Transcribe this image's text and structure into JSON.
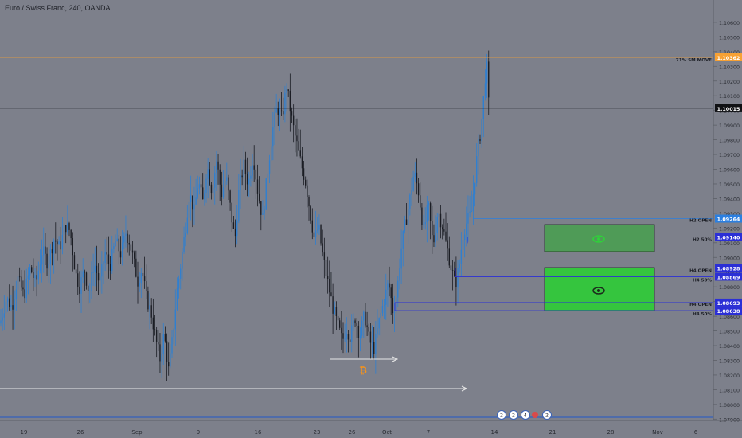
{
  "header": {
    "title": "Euro / Swiss Franc, 240, OANDA"
  },
  "colors": {
    "background": "#7d808b",
    "candle_up": "#2f7fd0",
    "candle_down": "#1b1d24",
    "orange_line": "#f7a134",
    "zone_dark": "#4f9b57",
    "zone_bright": "#35c53e",
    "level_line": "#2b2fd6",
    "open_level": "#2b7fe0"
  },
  "chart_data": {
    "type": "line",
    "instrument": "Euro / Swiss Franc",
    "timeframe": "240",
    "source": "OANDA",
    "x_tick_labels": [
      "19",
      "26",
      "Sep",
      "9",
      "16",
      "23",
      "26",
      "Oct",
      "7",
      "14",
      "21",
      "28",
      "Nov",
      "6"
    ],
    "y_tick_labels": [
      "1.10600",
      "1.10500",
      "1.10400",
      "1.10300",
      "1.10200",
      "1.10100",
      "1.10000",
      "1.09900",
      "1.09800",
      "1.09700",
      "1.09600",
      "1.09500",
      "1.09400",
      "1.09300",
      "1.09200",
      "1.09100",
      "1.09000",
      "1.08900",
      "1.08800",
      "1.08700",
      "1.08600",
      "1.08500",
      "1.08400",
      "1.08300",
      "1.08200",
      "1.08100",
      "1.08000",
      "1.07900"
    ],
    "ylim": [
      1.0788,
      1.1067
    ],
    "series": [
      {
        "price_path": [
          [
            0,
            1.0855
          ],
          [
            8,
            1.0872
          ],
          [
            15,
            1.0866
          ],
          [
            22,
            1.0886
          ],
          [
            30,
            1.0874
          ],
          [
            38,
            1.0893
          ],
          [
            45,
            1.0882
          ],
          [
            53,
            1.0905
          ],
          [
            60,
            1.0896
          ],
          [
            68,
            1.0913
          ],
          [
            75,
            1.0906
          ],
          [
            82,
            1.0922
          ],
          [
            88,
            1.0918
          ],
          [
            95,
            1.0889
          ],
          [
            100,
            1.088
          ],
          [
            106,
            1.0892
          ],
          [
            112,
            1.0875
          ],
          [
            118,
            1.0897
          ],
          [
            125,
            1.0882
          ],
          [
            132,
            1.0903
          ],
          [
            138,
            1.0894
          ],
          [
            145,
            1.0911
          ],
          [
            152,
            1.0902
          ],
          [
            158,
            1.0917
          ],
          [
            163,
            1.091
          ],
          [
            168,
            1.0897
          ],
          [
            173,
            1.0884
          ],
          [
            178,
            1.0892
          ],
          [
            184,
            1.0872
          ],
          [
            190,
            1.0862
          ],
          [
            196,
            1.0843
          ],
          [
            201,
            1.0831
          ],
          [
            206,
            1.0848
          ],
          [
            212,
            1.0822
          ],
          [
            217,
            1.0847
          ],
          [
            222,
            1.0876
          ],
          [
            228,
            1.0899
          ],
          [
            233,
            1.0921
          ],
          [
            238,
            1.0944
          ],
          [
            244,
            1.0931
          ],
          [
            249,
            1.0952
          ],
          [
            255,
            1.0937
          ],
          [
            260,
            1.0963
          ],
          [
            266,
            1.0946
          ],
          [
            272,
            1.0966
          ],
          [
            278,
            1.0943
          ],
          [
            284,
            1.0955
          ],
          [
            290,
            1.0931
          ],
          [
            295,
            1.0911
          ],
          [
            300,
            1.0945
          ],
          [
            306,
            1.0963
          ],
          [
            312,
            1.095
          ],
          [
            318,
            1.097
          ],
          [
            324,
            1.0944
          ],
          [
            330,
            1.0926
          ],
          [
            336,
            1.0958
          ],
          [
            342,
            1.0986
          ],
          [
            348,
            1.1002
          ],
          [
            354,
            1.0994
          ],
          [
            360,
            1.1017
          ],
          [
            366,
            1.0995
          ],
          [
            372,
            1.0979
          ],
          [
            378,
            1.0964
          ],
          [
            384,
            1.0951
          ],
          [
            390,
            1.0929
          ],
          [
            395,
            1.0912
          ],
          [
            400,
            1.0921
          ],
          [
            406,
            1.0899
          ],
          [
            412,
            1.0882
          ],
          [
            418,
            1.0866
          ],
          [
            424,
            1.0854
          ],
          [
            430,
            1.0843
          ],
          [
            435,
            1.0852
          ],
          [
            440,
            1.0846
          ],
          [
            446,
            1.0859
          ],
          [
            452,
            1.0847
          ],
          [
            458,
            1.0861
          ],
          [
            464,
            1.0843
          ],
          [
            470,
            1.0838
          ],
          [
            476,
            1.0856
          ],
          [
            482,
            1.087
          ],
          [
            488,
            1.0883
          ],
          [
            494,
            1.0862
          ],
          [
            499,
            1.0878
          ],
          [
            503,
            1.0902
          ],
          [
            508,
            1.092
          ],
          [
            514,
            1.0937
          ],
          [
            520,
            1.0958
          ],
          [
            526,
            1.0944
          ],
          [
            532,
            1.0918
          ],
          [
            538,
            1.0935
          ],
          [
            544,
            1.0908
          ],
          [
            550,
            1.0932
          ],
          [
            556,
            1.0921
          ],
          [
            562,
            1.0905
          ],
          [
            568,
            1.089
          ],
          [
            572,
            1.0881
          ],
          [
            577,
            1.0895
          ],
          [
            582,
            1.0918
          ],
          [
            587,
            1.0925
          ],
          [
            592,
            1.093
          ],
          [
            596,
            1.0952
          ],
          [
            600,
            1.0973
          ],
          [
            604,
            1.0987
          ],
          [
            608,
            1.1012
          ],
          [
            611,
            1.1035
          ],
          [
            614,
            1.1002
          ]
        ]
      }
    ],
    "horizontal_levels": [
      {
        "label": "71% SM MOVE",
        "price": "1.10362",
        "value": 1.10362
      },
      {
        "label": "",
        "price": "1.10015",
        "value": 1.10015
      },
      {
        "label": "",
        "price": "1.09264",
        "value": 1.09264
      },
      {
        "label": "H2 OPEN",
        "value": 1.09264
      },
      {
        "label": "H2 50%",
        "price": "1.09140",
        "value": 1.0914
      },
      {
        "label": "H4 OPEN",
        "price": "1.08928",
        "value": 1.08928
      },
      {
        "label": "H4 50%",
        "price": "1.08869",
        "value": 1.08869
      },
      {
        "label": "H4 OPEN",
        "price": "1.08693",
        "value": 1.08693
      },
      {
        "label": "H4 50%",
        "price": "1.08638",
        "value": 1.08638
      }
    ],
    "zones": [
      {
        "name": "H2 zone",
        "top": 1.0927,
        "bottom": 1.0905
      },
      {
        "name": "H4 zone",
        "top": 1.0891,
        "bottom": 1.0864
      }
    ],
    "bottom_event_badges": [
      "2",
      "2",
      "4",
      "2"
    ],
    "grid": false
  }
}
